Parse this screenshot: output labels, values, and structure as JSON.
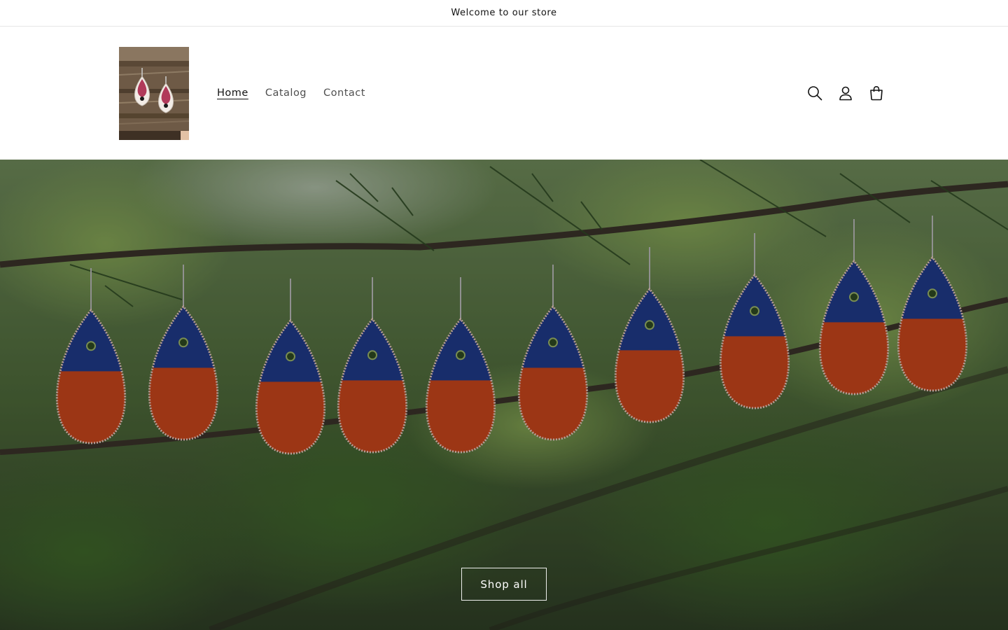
{
  "announcement": {
    "text": "Welcome to our store"
  },
  "header": {
    "logo": {
      "alt": "store logo earrings"
    },
    "nav": [
      {
        "label": "Home",
        "active": true
      },
      {
        "label": "Catalog",
        "active": false
      },
      {
        "label": "Contact",
        "active": false
      }
    ],
    "icons": [
      {
        "name": "search-icon"
      },
      {
        "name": "account-icon"
      },
      {
        "name": "cart-icon"
      }
    ]
  },
  "hero": {
    "image": "earrings-on-branch",
    "button_label": "Shop all"
  },
  "colors": {
    "text": "#121212",
    "earring_blue": "#1f3a8a",
    "earring_orange": "#c8461c",
    "foliage": "#4a6b2e",
    "button_border": "#ffffff"
  }
}
